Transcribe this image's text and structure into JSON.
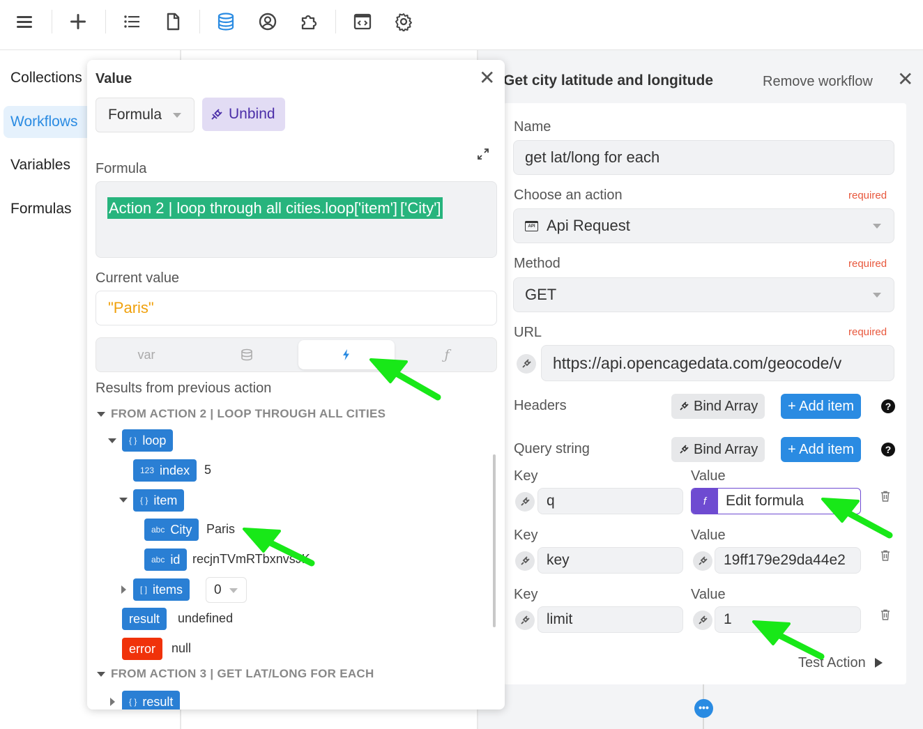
{
  "colors": {
    "accent": "#2a8be2",
    "purple": "#6e4bd1",
    "green_token": "#27b47d",
    "error_red": "#f0320a",
    "required_red": "#e8583d",
    "arrow_green": "#18e818"
  },
  "toolbar": {
    "icons": [
      "menu-icon",
      "plus-icon",
      "list-icon",
      "document-icon",
      "database-icon",
      "user-circle-icon",
      "puzzle-icon",
      "code-window-icon",
      "gear-icon"
    ]
  },
  "leftnav": {
    "items": [
      {
        "label": "Collections"
      },
      {
        "label": "Workflows"
      },
      {
        "label": "Variables"
      },
      {
        "label": "Formulas"
      }
    ]
  },
  "popup": {
    "title": "Value",
    "mode": "Formula",
    "unbind_label": "Unbind",
    "formula_label": "Formula",
    "formula_token_1": "Action 2 | loop through all cities.loop['item']",
    "formula_token_2": "['City']",
    "current_value_label": "Current value",
    "current_value": "\"Paris\"",
    "tabs": [
      {
        "label": "var"
      },
      {
        "icon": "database-icon"
      },
      {
        "icon": "lightning-icon"
      },
      {
        "icon": "function-icon"
      }
    ],
    "results_label": "Results from previous action",
    "section1": "FROM ACTION 2 | LOOP THROUGH ALL CITIES",
    "tree": {
      "loop": {
        "type": "{ }",
        "name": "loop"
      },
      "index": {
        "type": "123",
        "name": "index",
        "value": "5"
      },
      "item": {
        "type": "{ }",
        "name": "item"
      },
      "city": {
        "type": "abc",
        "name": "City",
        "value": "Paris"
      },
      "id": {
        "type": "abc",
        "name": "id",
        "value": "recjnTVmRTbxnvsJK"
      },
      "items": {
        "type": "[ ]",
        "name": "items",
        "selected": "0"
      },
      "result": {
        "name": "result",
        "value": "undefined"
      },
      "error": {
        "name": "error",
        "value": "null"
      }
    },
    "section2": "FROM ACTION 3 | GET LAT/LONG FOR EACH",
    "result2": {
      "type": "{ }",
      "name": "result"
    }
  },
  "workflow": {
    "title": "Get city latitude and longitude",
    "remove_label": "Remove workflow",
    "name_label": "Name",
    "name_value": "get lat/long for each",
    "action_label": "Choose an action",
    "required": "required",
    "action_value": "Api Request",
    "action_icon_text": "API",
    "method_label": "Method",
    "method_value": "GET",
    "url_label": "URL",
    "url_value": "https://api.opencagedata.com/geocode/v",
    "headers_label": "Headers",
    "query_label": "Query string",
    "bind_array": "Bind Array",
    "add_item": "+ Add item",
    "help": "?",
    "key_label": "Key",
    "value_label": "Value",
    "query_rows": [
      {
        "key": "q",
        "value": "Edit formula",
        "fx": "f"
      },
      {
        "key": "key",
        "value": "19ff179e29da44e2"
      },
      {
        "key": "limit",
        "value": "1"
      }
    ],
    "test_action": "Test Action",
    "dots": "•••"
  }
}
